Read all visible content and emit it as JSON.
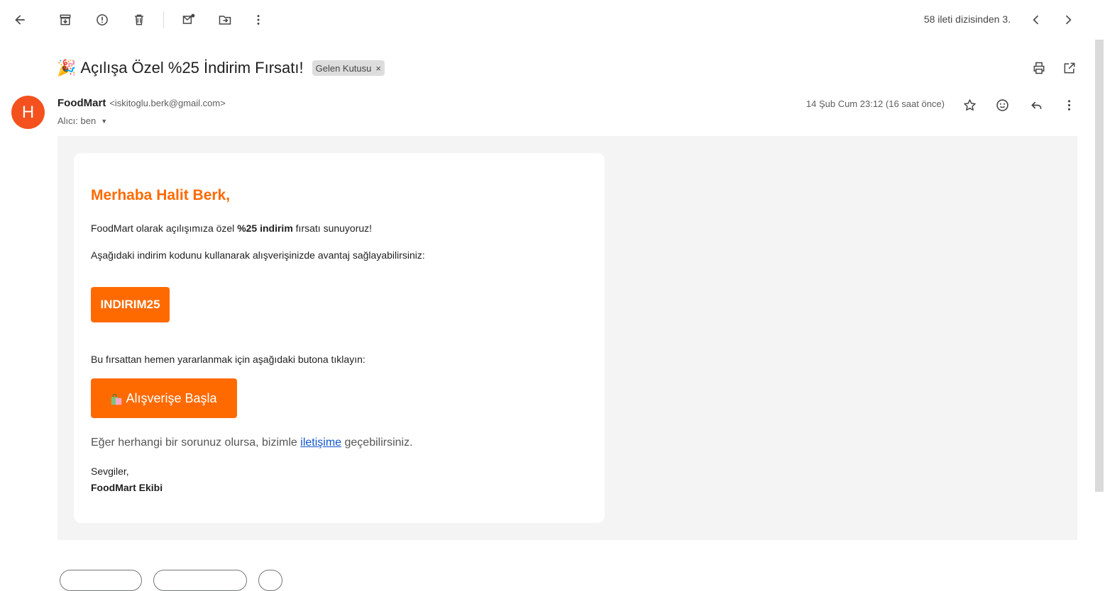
{
  "toolbar": {
    "pager_text": "58 ileti dizisinden 3."
  },
  "message": {
    "subject": "Açılışa Özel %25 İndirim Fırsatı!",
    "subject_emoji": "🎉",
    "label": "Gelen Kutusu",
    "label_remove": "×",
    "sender_initial": "H",
    "sender_name": "FoodMart",
    "sender_email": "<iskitoglu.berk@gmail.com>",
    "to_text": "Alıcı: ben",
    "date": "14 Şub Cum 23:12 (16 saat önce)"
  },
  "email": {
    "greeting": "Merhaba Halit Berk,",
    "p1_before": "FoodMart olarak açılışımıza özel ",
    "p1_bold": "%25 indirim",
    "p1_after": " fırsatı sunuyoruz!",
    "p2": "Aşağıdaki indirim kodunu kullanarak alışverişinizde avantaj sağlayabilirsiniz:",
    "code": "INDIRIM25",
    "p3": "Bu fırsattan hemen yararlanmak için aşağıdaki butona tıklayın:",
    "cta_label": "Alışverişe Başla",
    "p4_before": "Eğer herhangi bir sorunuz olursa, bizimle ",
    "p4_link": "iletişime",
    "p4_after": " geçebilirsiniz.",
    "closing": "Sevgiler,",
    "signature": "FoodMart Ekibi"
  },
  "colors": {
    "accent": "#ff6a00",
    "avatar": "#f4511e",
    "link": "#1155cc"
  }
}
